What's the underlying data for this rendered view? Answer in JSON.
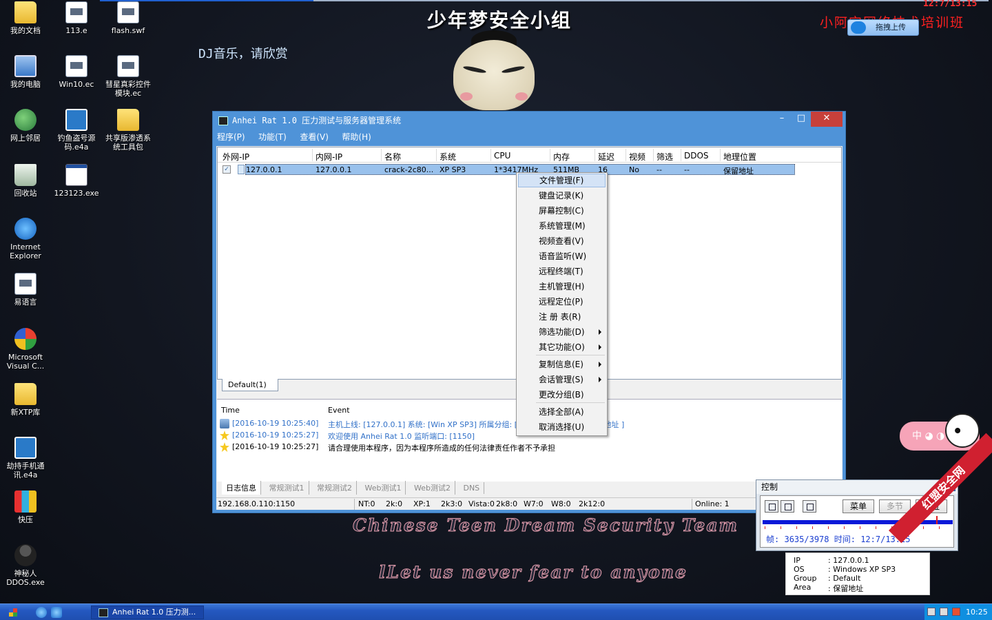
{
  "desktop_icons": [
    {
      "label": "我的文档",
      "icon": "folder-icon"
    },
    {
      "label": "113.e",
      "icon": "file-icon"
    },
    {
      "label": "flash.swf",
      "icon": "file-icon"
    },
    {
      "label": "我的电脑",
      "icon": "computer-icon"
    },
    {
      "label": "Win10.ec",
      "icon": "file-icon"
    },
    {
      "label": "彗星真彩控件模块.ec",
      "icon": "file-icon"
    },
    {
      "label": "网上邻居",
      "icon": "network-icon"
    },
    {
      "label": "钓鱼盗号源码.e4a",
      "icon": "e4a-icon"
    },
    {
      "label": "共享版渗透系统工具包",
      "icon": "folder-icon"
    },
    {
      "label": "回收站",
      "icon": "recycle-bin-icon"
    },
    {
      "label": "123123.exe",
      "icon": "exe-icon"
    },
    {
      "label": "Internet Explorer",
      "icon": "ie-icon"
    },
    {
      "label": "易语言",
      "icon": "file-icon"
    },
    {
      "label": "Microsoft Visual C...",
      "icon": "msvc-icon"
    },
    {
      "label": "新XTP库",
      "icon": "folder-icon"
    },
    {
      "label": "劫持手机通讯.e4a",
      "icon": "e4a-icon"
    },
    {
      "label": "快压",
      "icon": "zip-icon"
    },
    {
      "label": "神秘人DDOS.exe",
      "icon": "person-icon"
    }
  ],
  "overlay": {
    "title": "少年梦安全小组",
    "dj": "DJ音乐，请欣赏",
    "clock": "12:7/13:15",
    "training": "小阿宝网络技术培训班",
    "upload": "拖拽上传",
    "team_line1": "Chinese Teen Dream Security Team",
    "team_line2": "lLet us never fear to anyone"
  },
  "window": {
    "title": "Anhei Rat 1.0 压力测试与服务器管理系统",
    "minimize": "–",
    "maximize": "□",
    "close": "✕",
    "menu": [
      "程序(P)",
      "功能(T)",
      "查看(V)",
      "帮助(H)"
    ],
    "columns": [
      "外网-IP",
      "内网-IP",
      "名称",
      "系统",
      "CPU",
      "内存",
      "延迟",
      "视频",
      "筛选",
      "DDOS",
      "地理位置"
    ],
    "row": [
      "127.0.0.1",
      "127.0.0.1",
      "crack-2c80...",
      "XP SP3",
      "1*3417MHz",
      "511MB",
      "16",
      "No",
      "--",
      "--",
      "保留地址"
    ],
    "row_checked": "✓",
    "group_tab": "Default(1)",
    "log_head": {
      "time": "Time",
      "event": "Event"
    },
    "logs": [
      {
        "time": "[2016-10-19 10:25:40]",
        "event": "主机上线: [127.0.0.1]  系统: [Win XP SP3]  所属分组: [Default]  地理位置: [保留地址 ]",
        "icon": "network-icon",
        "color": "#3070c8"
      },
      {
        "time": "[2016-10-19 10:25:27]",
        "event": "欢迎使用 Anhei Rat 1.0  监听端口: [1150]",
        "icon": "star-icon",
        "color": "#3070c8"
      },
      {
        "time": "[2016-10-19 10:25:27]",
        "event": "请合理使用本程序，因为本程序所造成的任何法律责任作者不予承担",
        "icon": "star-icon",
        "color": "#000000"
      }
    ],
    "bottom_tabs": [
      "日志信息",
      "常规测试1",
      "常规测试2",
      "Web测试1",
      "Web测试2",
      "DNS"
    ],
    "status": {
      "address": "192.168.0.110:1150",
      "counts": [
        "NT:0",
        "2k:0",
        "XP:1",
        "2k3:0",
        "Vista:0",
        "2k8:0",
        "W7:0",
        "W8:0",
        "2k12:0"
      ],
      "online": "Online: 1"
    }
  },
  "context_menu": [
    {
      "label": "文件管理(F)",
      "submenu": false
    },
    {
      "label": "键盘记录(K)",
      "submenu": false
    },
    {
      "label": "屏幕控制(C)",
      "submenu": false
    },
    {
      "label": "系统管理(M)",
      "submenu": false
    },
    {
      "label": "视频查看(V)",
      "submenu": false
    },
    {
      "label": "语音监听(W)",
      "submenu": false
    },
    {
      "label": "远程终端(T)",
      "submenu": false
    },
    {
      "label": "主机管理(H)",
      "submenu": false
    },
    {
      "label": "远程定位(P)",
      "submenu": false
    },
    {
      "label": "注 册 表(R)",
      "submenu": false
    },
    {
      "label": "筛选功能(D)",
      "submenu": true
    },
    {
      "label": "其它功能(O)",
      "submenu": true
    },
    {
      "label": "复制信息(E)",
      "submenu": true
    },
    {
      "label": "会话管理(S)",
      "submenu": true
    },
    {
      "label": "更改分组(B)",
      "submenu": false
    },
    {
      "label": "选择全部(A)",
      "submenu": false
    },
    {
      "label": "取消选择(U)",
      "submenu": false
    }
  ],
  "control": {
    "title": "控制",
    "close": "x",
    "buttons": [
      "菜单",
      "多节",
      "定位"
    ],
    "frame_label": "帧:",
    "frame": "3635/3978",
    "time_label": "时间:",
    "time": "12:7/13:15",
    "progress": 0.914
  },
  "tooltip": {
    "ip_label": "IP",
    "ip": ": 127.0.0.1",
    "os_label": "OS",
    "os": ": Windows XP SP3",
    "group_label": "Group",
    "group": ": Default",
    "area_label": "Area",
    "area": ": 保留地址"
  },
  "sticker": {
    "text": "中 ◕ ◑"
  },
  "watermark": "红盟安全网",
  "taskbar": {
    "task_label": "Anhei Rat 1.0 压力测...",
    "clock": "10:25"
  }
}
